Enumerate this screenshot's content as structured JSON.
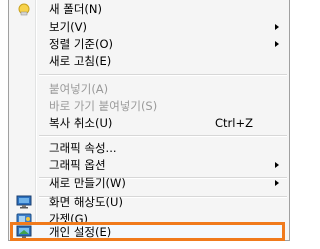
{
  "menu": {
    "items": [
      {
        "label": "새 폴더(N)",
        "icon": "folder-icon"
      },
      {
        "label": "보기(V)",
        "submenu": true
      },
      {
        "label": "정렬 기준(O)",
        "submenu": true
      },
      {
        "label": "새로 고침(E)"
      },
      {
        "label": "붙여넣기(A)",
        "disabled": true
      },
      {
        "label": "바로 가기 붙여넣기(S)",
        "disabled": true
      },
      {
        "label": "복사 취소(U)",
        "shortcut": "Ctrl+Z"
      },
      {
        "label": "그래픽 속성..."
      },
      {
        "label": "그래픽 옵션",
        "submenu": true
      },
      {
        "label": "새로 만들기(W)",
        "submenu": true
      },
      {
        "label": "화면 해상도(U)",
        "icon": "display-icon"
      },
      {
        "label": "가젯(G)",
        "icon": "gadget-icon"
      },
      {
        "label": "개인 설정(E)",
        "icon": "personalize-icon",
        "highlighted": true
      }
    ]
  },
  "colors": {
    "menu_background": "#f5f5f5",
    "highlight_border": "#f07a1c",
    "disabled_text": "#9a9a9a"
  }
}
